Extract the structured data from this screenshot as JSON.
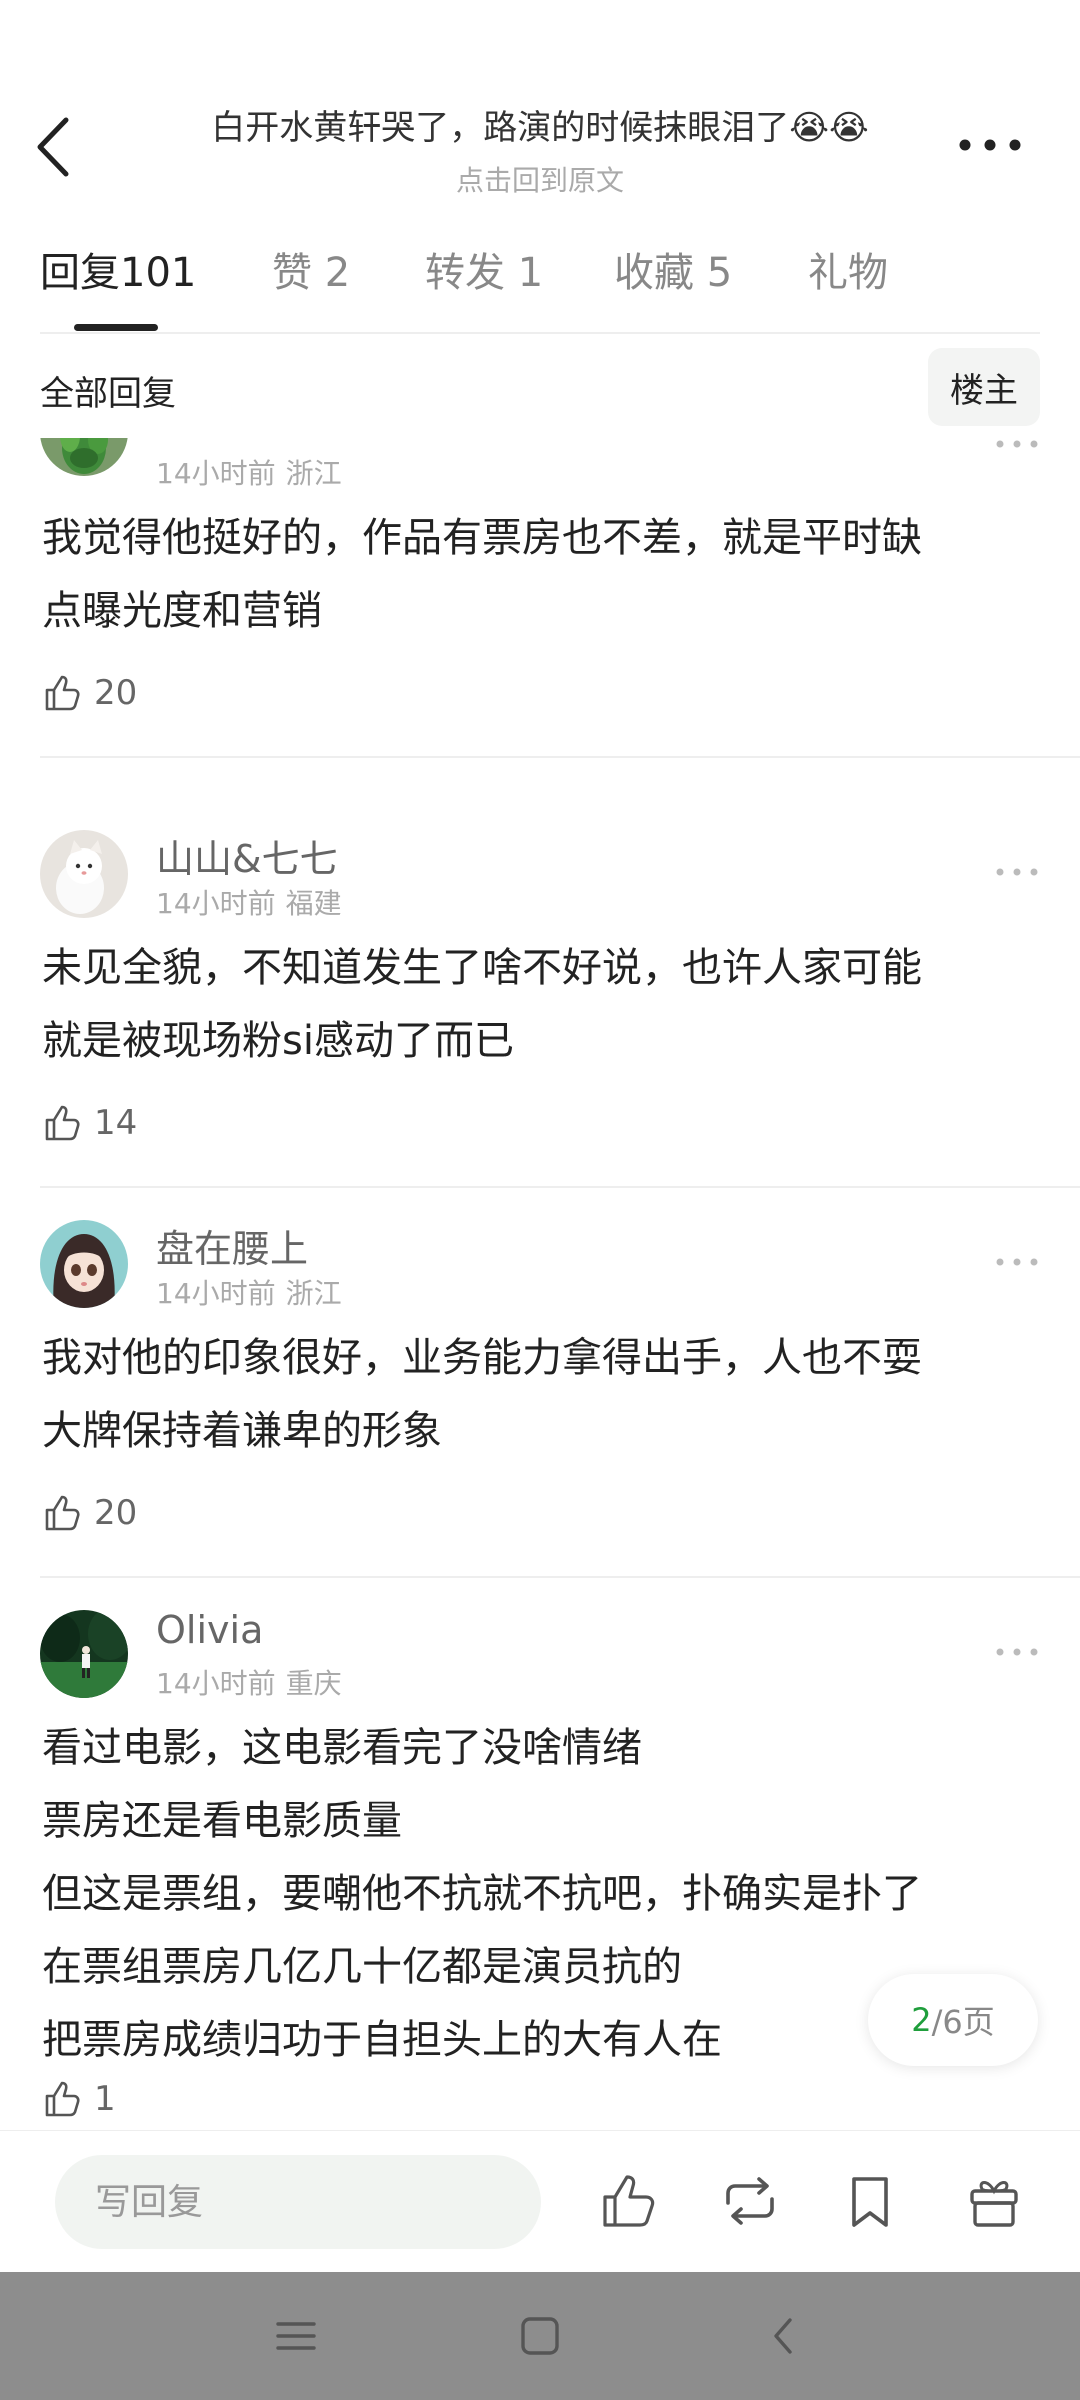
{
  "header": {
    "title": "白开水黄轩哭了，路演的时候抹眼泪了😭😭",
    "subtitle": "点击回到原文"
  },
  "tabs": [
    {
      "label": "回复",
      "count": "101"
    },
    {
      "label": "赞",
      "count": "2"
    },
    {
      "label": "转发",
      "count": "1"
    },
    {
      "label": "收藏",
      "count": "5"
    },
    {
      "label": "礼物",
      "count": ""
    }
  ],
  "filter": {
    "label": "全部回复",
    "owner_button": "楼主"
  },
  "comments": [
    {
      "username": "",
      "time": "14小时前",
      "location": "浙江",
      "lines": [
        "我觉得他挺好的，作品有票房也不差，就是平时缺",
        "点曝光度和营销"
      ],
      "likes": "20",
      "avatar": "green-plant-avatar"
    },
    {
      "username": "山山&七七",
      "time": "14小时前",
      "location": "福建",
      "lines": [
        "未见全貌，不知道发生了啥不好说，也许人家可能",
        "就是被现场粉si感动了而已"
      ],
      "likes": "14",
      "avatar": "white-cat-avatar"
    },
    {
      "username": "盘在腰上",
      "time": "14小时前",
      "location": "浙江",
      "lines": [
        "我对他的印象很好，业务能力拿得出手，人也不耍",
        "大牌保持着谦卑的形象"
      ],
      "likes": "20",
      "avatar": "anime-girl-avatar"
    },
    {
      "username": "Olivia",
      "time": "14小时前",
      "location": "重庆",
      "lines": [
        "看过电影，这电影看完了没啥情绪",
        "票房还是看电影质量",
        "但这是票组，要嘲他不抗就不抗吧，扑确实是扑了",
        "在票组票房几亿几十亿都是演员抗的",
        "把票房成绩归功于自担头上的大有人在"
      ],
      "likes": "1",
      "avatar": "forest-photo-avatar"
    }
  ],
  "pager": {
    "current": "2",
    "total": "/6页"
  },
  "bottom_bar": {
    "reply_placeholder": "写回复",
    "icons": [
      "thumbs-up-icon",
      "repost-icon",
      "bookmark-icon",
      "gift-icon"
    ]
  },
  "system_nav": {
    "icons": [
      "menu-icon",
      "home-square-icon",
      "back-triangle-icon"
    ]
  },
  "colors": {
    "accent": "#1f9e3c",
    "divider": "#eeeeee",
    "nav_bar": "#8d8d8d"
  }
}
